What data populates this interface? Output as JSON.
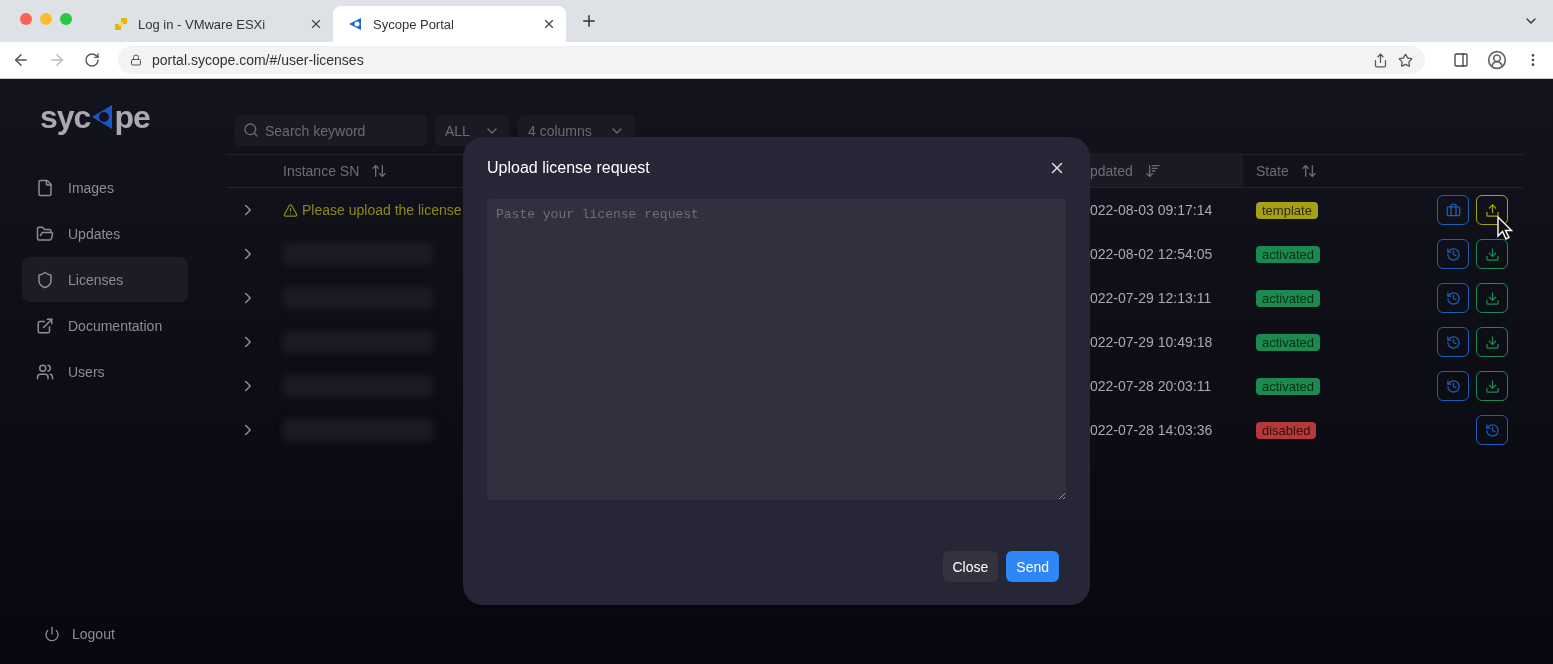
{
  "browser": {
    "tabs": [
      {
        "title": "Log in - VMware ESXi",
        "selected": false,
        "kind": "vmware"
      },
      {
        "title": "Sycope Portal",
        "selected": true,
        "kind": "sycope"
      }
    ],
    "url": "portal.sycope.com/#/user-licenses"
  },
  "sidebar": {
    "logo": {
      "before": "syc",
      "after": "pe"
    },
    "items": [
      {
        "label": "Images",
        "selected": false
      },
      {
        "label": "Updates",
        "selected": false
      },
      {
        "label": "Licenses",
        "selected": true
      },
      {
        "label": "Documentation",
        "selected": false
      },
      {
        "label": "Users",
        "selected": false
      }
    ],
    "logout": "Logout"
  },
  "toolbar": {
    "search": {
      "placeholder": "Search keyword"
    },
    "filter": "ALL",
    "columns": "4 columns"
  },
  "table": {
    "columns": [
      {
        "label": "Instance SN",
        "sorted": false
      },
      {
        "label": "pdated",
        "sorted": true
      },
      {
        "label": "State",
        "sorted": false
      }
    ],
    "rows": [
      {
        "sn": {
          "kind": "warning",
          "text": "Please upload the license"
        },
        "updated": "022-08-03 09:17:14",
        "state": {
          "label": "template",
          "kind": "template"
        },
        "actions": [
          {
            "kind": "briefcase"
          },
          {
            "kind": "upload"
          }
        ]
      },
      {
        "sn": {
          "kind": "blurred"
        },
        "updated": "022-08-02 12:54:05",
        "state": {
          "label": "activated",
          "kind": "activated"
        },
        "actions": [
          {
            "kind": "history"
          },
          {
            "kind": "download"
          }
        ]
      },
      {
        "sn": {
          "kind": "blurred"
        },
        "updated": "022-07-29 12:13:11",
        "state": {
          "label": "activated",
          "kind": "activated"
        },
        "actions": [
          {
            "kind": "history"
          },
          {
            "kind": "download"
          }
        ]
      },
      {
        "sn": {
          "kind": "blurred"
        },
        "updated": "022-07-29 10:49:18",
        "state": {
          "label": "activated",
          "kind": "activated"
        },
        "actions": [
          {
            "kind": "history"
          },
          {
            "kind": "download"
          }
        ]
      },
      {
        "sn": {
          "kind": "blurred"
        },
        "updated": "022-07-28 20:03:11",
        "state": {
          "label": "activated",
          "kind": "activated"
        },
        "actions": [
          {
            "kind": "history"
          },
          {
            "kind": "download"
          }
        ]
      },
      {
        "sn": {
          "kind": "blurred"
        },
        "updated": "022-07-28 14:03:36",
        "state": {
          "label": "disabled",
          "kind": "disabled"
        },
        "actions": [
          {
            "kind": "history"
          }
        ]
      }
    ]
  },
  "dialog": {
    "title": "Upload license request",
    "placeholder": "Paste your license request",
    "buttons": [
      {
        "label": "Close",
        "kind": "secondary"
      },
      {
        "label": "Send",
        "kind": "primary"
      }
    ]
  }
}
